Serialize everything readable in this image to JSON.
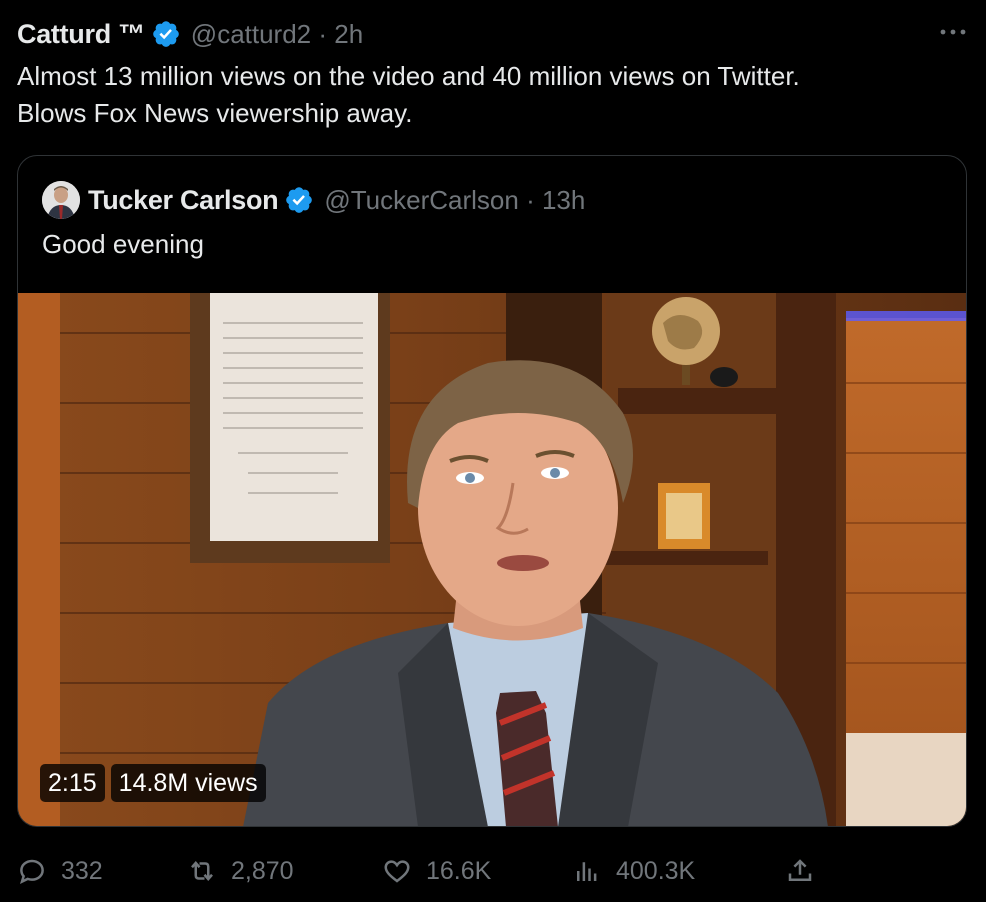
{
  "tweet": {
    "author_name": "Catturd ™",
    "handle_time": "@catturd2 · 2h",
    "text_lines": [
      "Almost 13 million views on the video and 40 million views on Twitter.",
      "Blows Fox News viewership away."
    ]
  },
  "quote": {
    "author_name": "Tucker Carlson",
    "handle_time": "@TuckerCarlson · 13h",
    "text": "Good evening",
    "video": {
      "duration": "2:15",
      "views": "14.8M views"
    }
  },
  "actions": {
    "replies": "332",
    "retweets": "2,870",
    "likes": "16.6K",
    "views": "400.3K"
  },
  "icons": {
    "verified": "verified-badge-icon",
    "more": "more-options-icon",
    "reply": "reply-icon",
    "retweet": "retweet-icon",
    "like": "heart-icon",
    "views": "analytics-icon",
    "share": "share-icon"
  },
  "colors": {
    "background": "#000000",
    "text": "#e7e9ea",
    "secondary": "#71767b",
    "verified": "#1d9bf0",
    "border": "#2f3336"
  }
}
